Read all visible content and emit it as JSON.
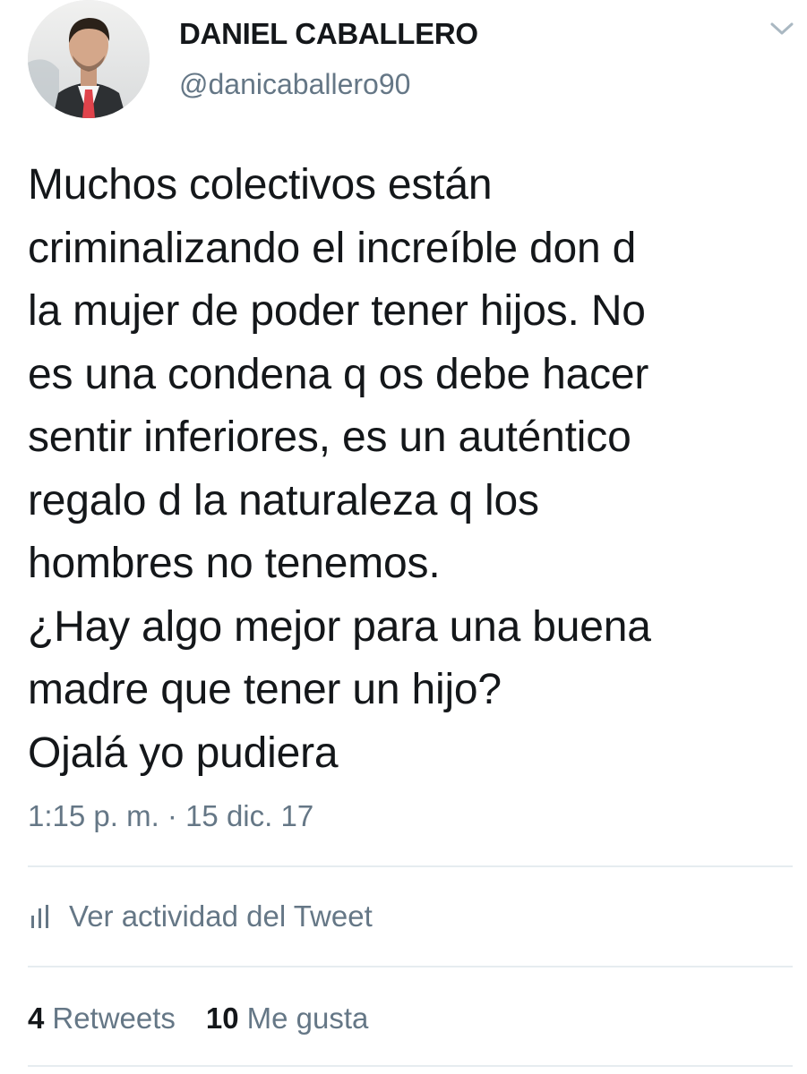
{
  "author": {
    "display_name": "DANIEL CABALLERO",
    "handle": "@danicaballero90"
  },
  "tweet": {
    "text": "Muchos colectivos están\ncriminalizando el increíble don d\nla mujer de poder tener hijos. No\nes una condena q os debe hacer\nsentir inferiores, es un auténtico\nregalo d la naturaleza q los\nhombres no tenemos.\n¿Hay algo mejor para una buena\nmadre que tener un hijo?\nOjalá yo pudiera",
    "timestamp": "1:15 p. m. · 15 dic. 17"
  },
  "activity": {
    "icon": "bar-chart-icon",
    "label": "Ver actividad del Tweet"
  },
  "stats": {
    "retweets_count": "4",
    "retweets_label": "Retweets",
    "likes_count": "10",
    "likes_label": "Me gusta"
  },
  "menu": {
    "icon": "chevron-down-icon"
  },
  "colors": {
    "text_primary": "#14171a",
    "text_secondary": "#657786",
    "divider": "#e6ecf0",
    "tie_accent": "#e0434b"
  }
}
